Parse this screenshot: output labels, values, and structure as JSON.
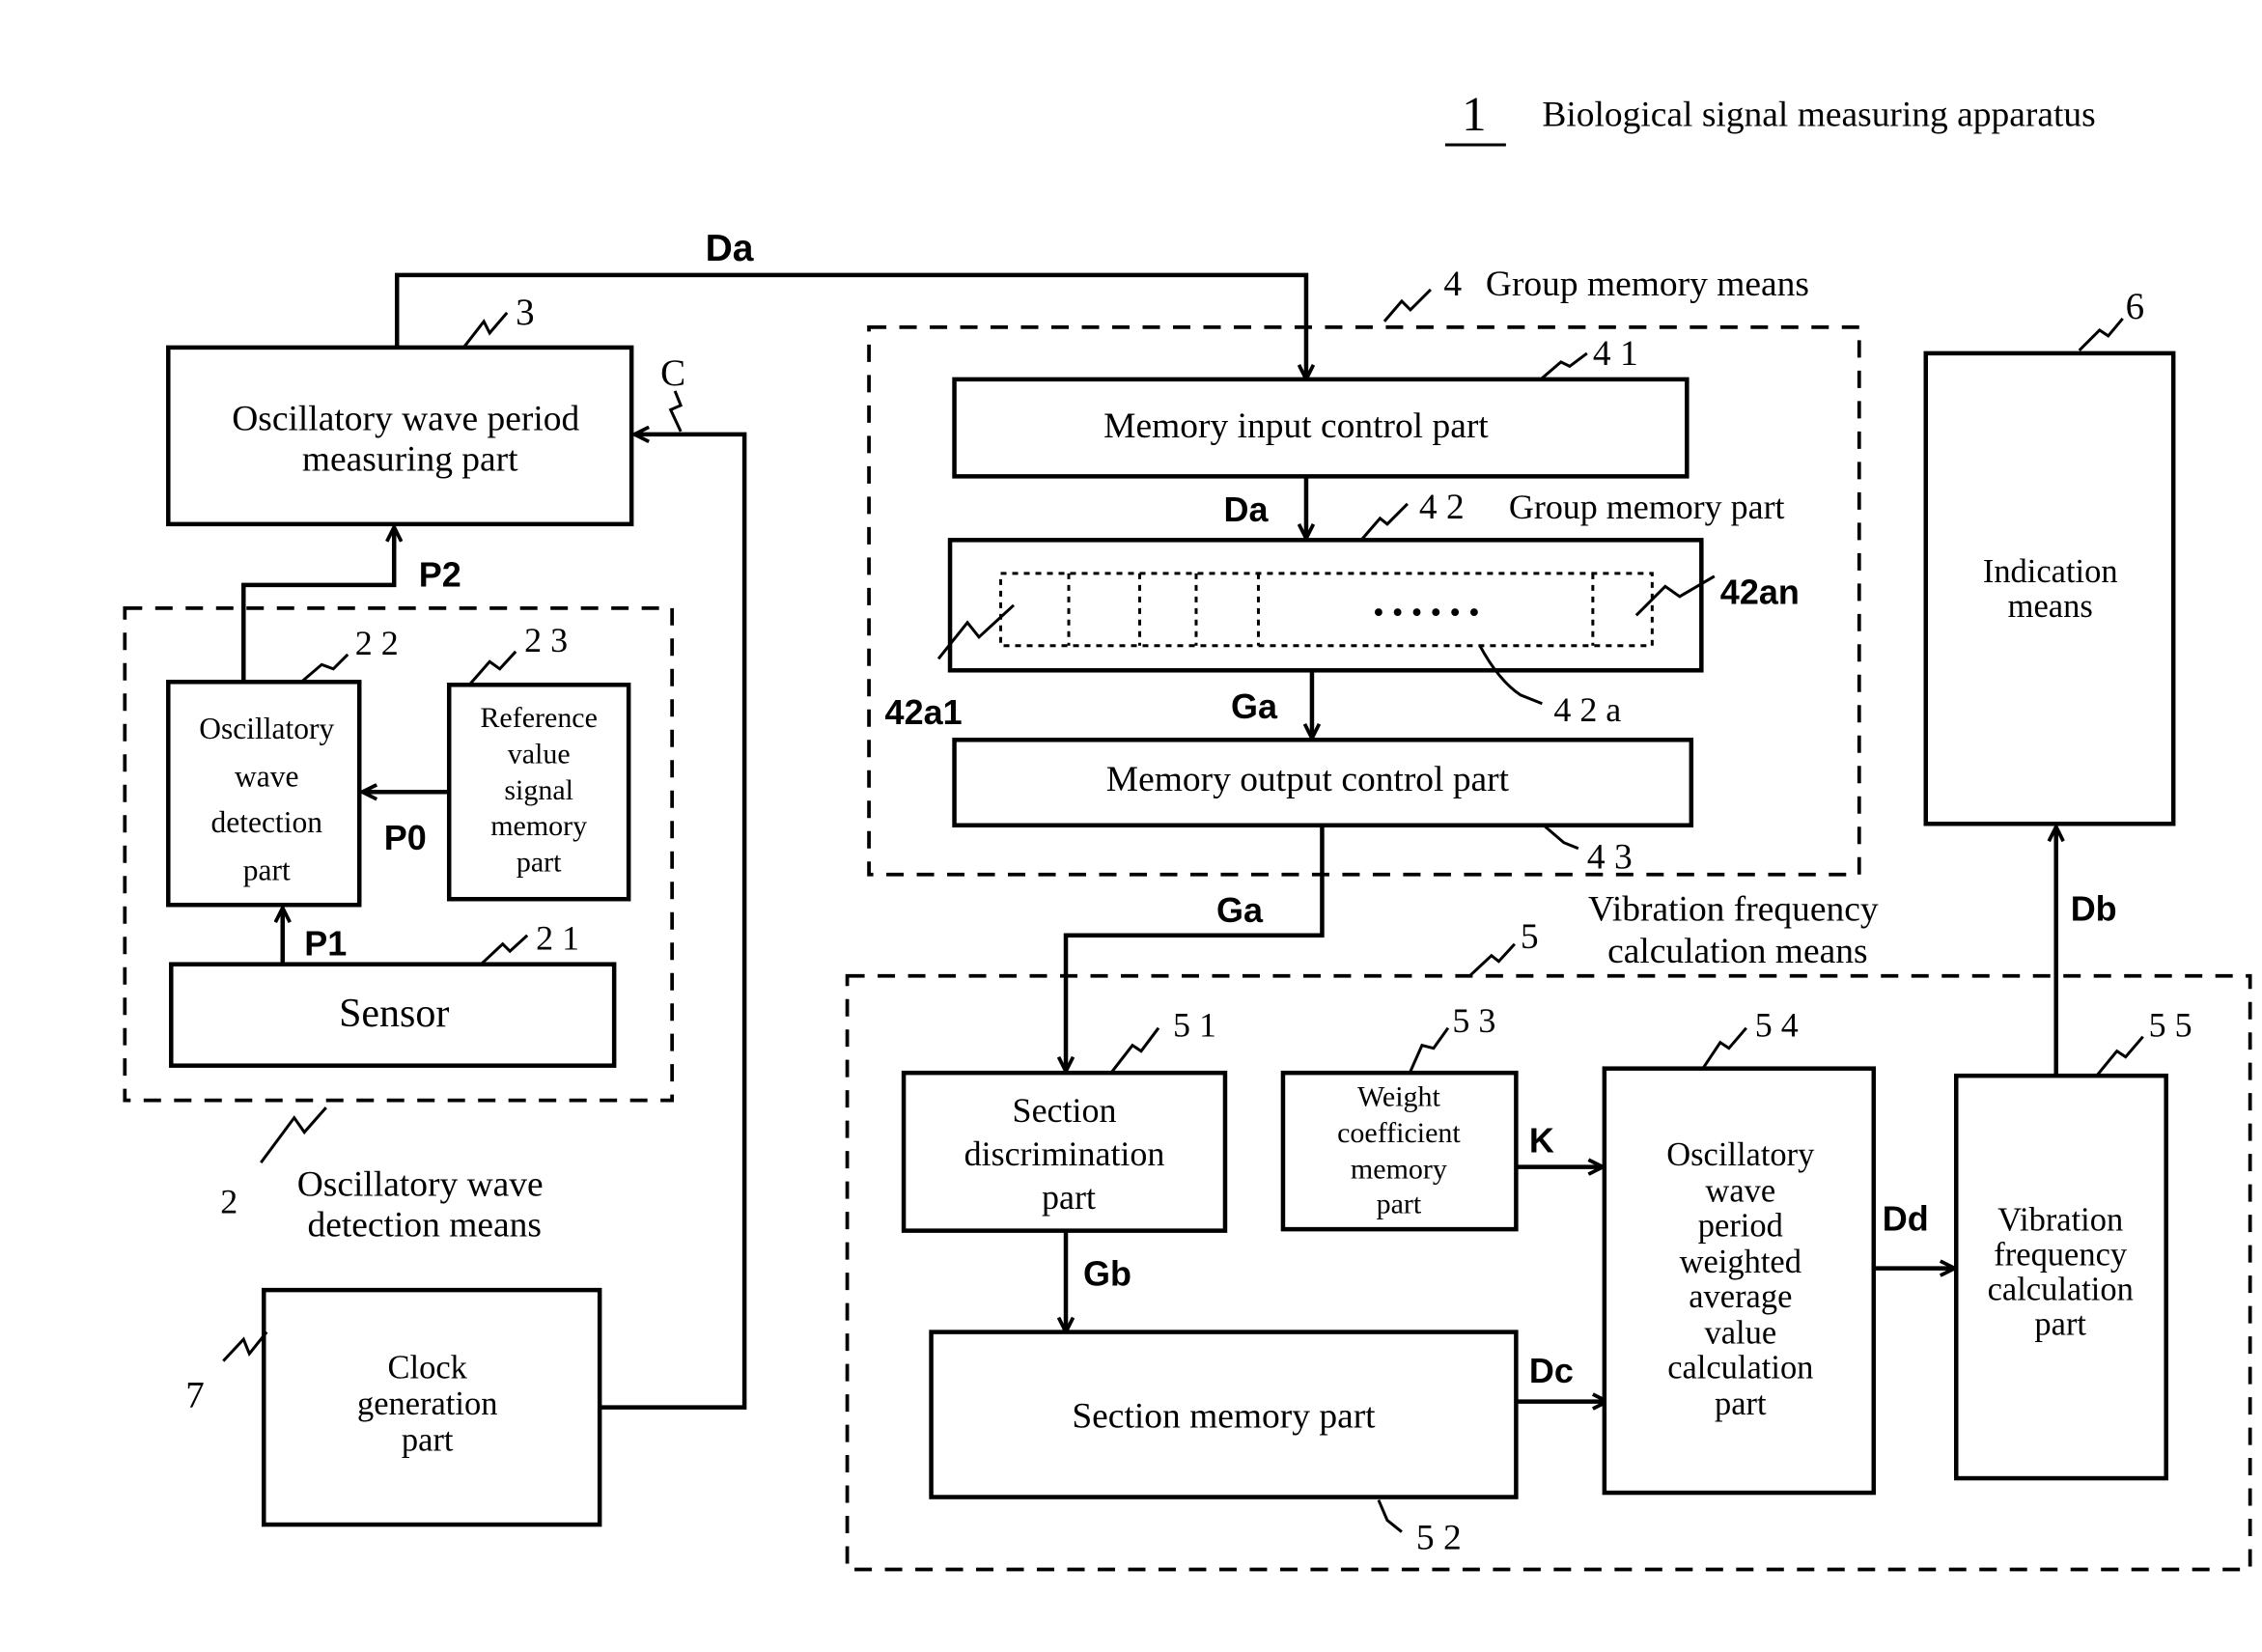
{
  "title": {
    "number": "1",
    "label": "Biological signal measuring apparatus"
  },
  "groups": {
    "oscillatory_detection": {
      "number": "2",
      "label_line1": "Oscillatory wave",
      "label_line2": "detection means"
    },
    "group_memory": {
      "number": "4",
      "label": "Group memory means"
    },
    "vibration_calc": {
      "number": "5",
      "label_line1": "Vibration frequency",
      "label_line2": "calculation means"
    }
  },
  "blocks": {
    "period_measuring": {
      "number": "3",
      "lines": [
        "Oscillatory wave period",
        "measuring part"
      ]
    },
    "wave_detection": {
      "number": "2 2",
      "lines": [
        "Oscillatory",
        "wave",
        "detection",
        "part"
      ]
    },
    "reference_memory": {
      "number": "2 3",
      "lines": [
        "Reference",
        "value",
        "signal",
        "memory",
        "part"
      ]
    },
    "sensor": {
      "number": "2 1",
      "lines": [
        "Sensor"
      ]
    },
    "clock": {
      "number": "7",
      "lines": [
        "Clock",
        "generation",
        "part"
      ]
    },
    "memory_input": {
      "number": "4 1",
      "lines": [
        "Memory input control part"
      ]
    },
    "group_memory_part": {
      "number": "4 2",
      "label": "Group memory part",
      "cell_first": "42a1",
      "cell_last": "42an",
      "cells": "4 2 a",
      "ellipsis": "• • • • • •"
    },
    "memory_output": {
      "number": "4 3",
      "lines": [
        "Memory output control part"
      ]
    },
    "indication": {
      "number": "6",
      "lines": [
        "Indication",
        "means"
      ]
    },
    "section_discrimination": {
      "number": "5 1",
      "lines": [
        "Section",
        "discrimination",
        "part"
      ]
    },
    "section_memory": {
      "number": "5 2",
      "lines": [
        "Section memory part"
      ]
    },
    "weight_coefficient": {
      "number": "5 3",
      "lines": [
        "Weight",
        "coefficient",
        "memory",
        "part"
      ]
    },
    "weighted_average": {
      "number": "5 4",
      "lines": [
        "Oscillatory",
        "wave",
        "period",
        "weighted",
        "average",
        "value",
        "calculation",
        "part"
      ]
    },
    "vibration_freq_part": {
      "number": "5 5",
      "lines": [
        "Vibration",
        "frequency",
        "calculation",
        "part"
      ]
    }
  },
  "signals": {
    "Da_top": "Da",
    "Da_mid": "Da",
    "C": "C",
    "P2": "P2",
    "P0": "P0",
    "P1": "P1",
    "Ga_mid": "Ga",
    "Ga_low": "Ga",
    "Gb": "Gb",
    "K": "K",
    "Dc": "Dc",
    "Dd": "Dd",
    "Db": "Db"
  }
}
